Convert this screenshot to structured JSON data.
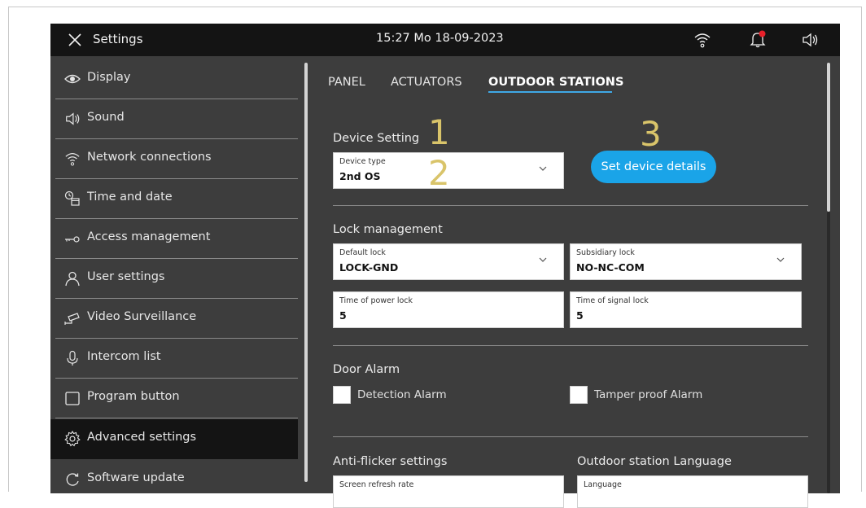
{
  "topbar": {
    "title": "Settings",
    "datetime": "15:27  Mo 18-09-2023",
    "icons": [
      "close-icon",
      "wifi-icon",
      "bell-icon",
      "speaker-icon"
    ],
    "notification_color": "#e8202a"
  },
  "sidebar": {
    "items": [
      {
        "label": "Display",
        "icon": "eye-icon"
      },
      {
        "label": "Sound",
        "icon": "speaker-icon"
      },
      {
        "label": "Network connections",
        "icon": "wifi-icon"
      },
      {
        "label": "Time and date",
        "icon": "clock-calendar-icon"
      },
      {
        "label": "Access  management",
        "icon": "key-icon"
      },
      {
        "label": "User settings",
        "icon": "user-icon"
      },
      {
        "label": "Video Surveillance",
        "icon": "camera-icon"
      },
      {
        "label": "Intercom list",
        "icon": "microphone-icon"
      },
      {
        "label": "Program button",
        "icon": "square-icon"
      },
      {
        "label": "Advanced settings",
        "icon": "gear-icon",
        "active": true
      },
      {
        "label": "Software update",
        "icon": "refresh-icon"
      }
    ]
  },
  "tabs": [
    {
      "label": "PANEL"
    },
    {
      "label": "ACTUATORS"
    },
    {
      "label": "OUTDOOR STATIONS",
      "active": true
    }
  ],
  "device_setting": {
    "title": "Device Setting",
    "device_type_label": "Device type",
    "device_type_value": "2nd OS",
    "button_label": "Set device details"
  },
  "annotations": [
    "1",
    "2",
    "3"
  ],
  "lock_management": {
    "title": "Lock management",
    "default_lock_label": "Default lock",
    "default_lock_value": "LOCK-GND",
    "subsidiary_lock_label": "Subsidiary lock",
    "subsidiary_lock_value": "NO-NC-COM",
    "power_lock_label": "Time of power lock",
    "power_lock_value": "5",
    "signal_lock_label": "Time of signal lock",
    "signal_lock_value": "5"
  },
  "door_alarm": {
    "title": "Door Alarm",
    "detection_label": "Detection Alarm",
    "tamper_label": "Tamper proof Alarm"
  },
  "bottom": {
    "antiflicker_title": "Anti-flicker settings",
    "language_title": "Outdoor station Language",
    "refresh_label": "Screen refresh rate",
    "language_label": "Language"
  },
  "colors": {
    "accent": "#1aa4e8",
    "tab_underline": "#3fa8e6",
    "panel_bg": "#3d3d3d",
    "topbar_bg": "#141414",
    "annotation": "#d9c46a"
  }
}
